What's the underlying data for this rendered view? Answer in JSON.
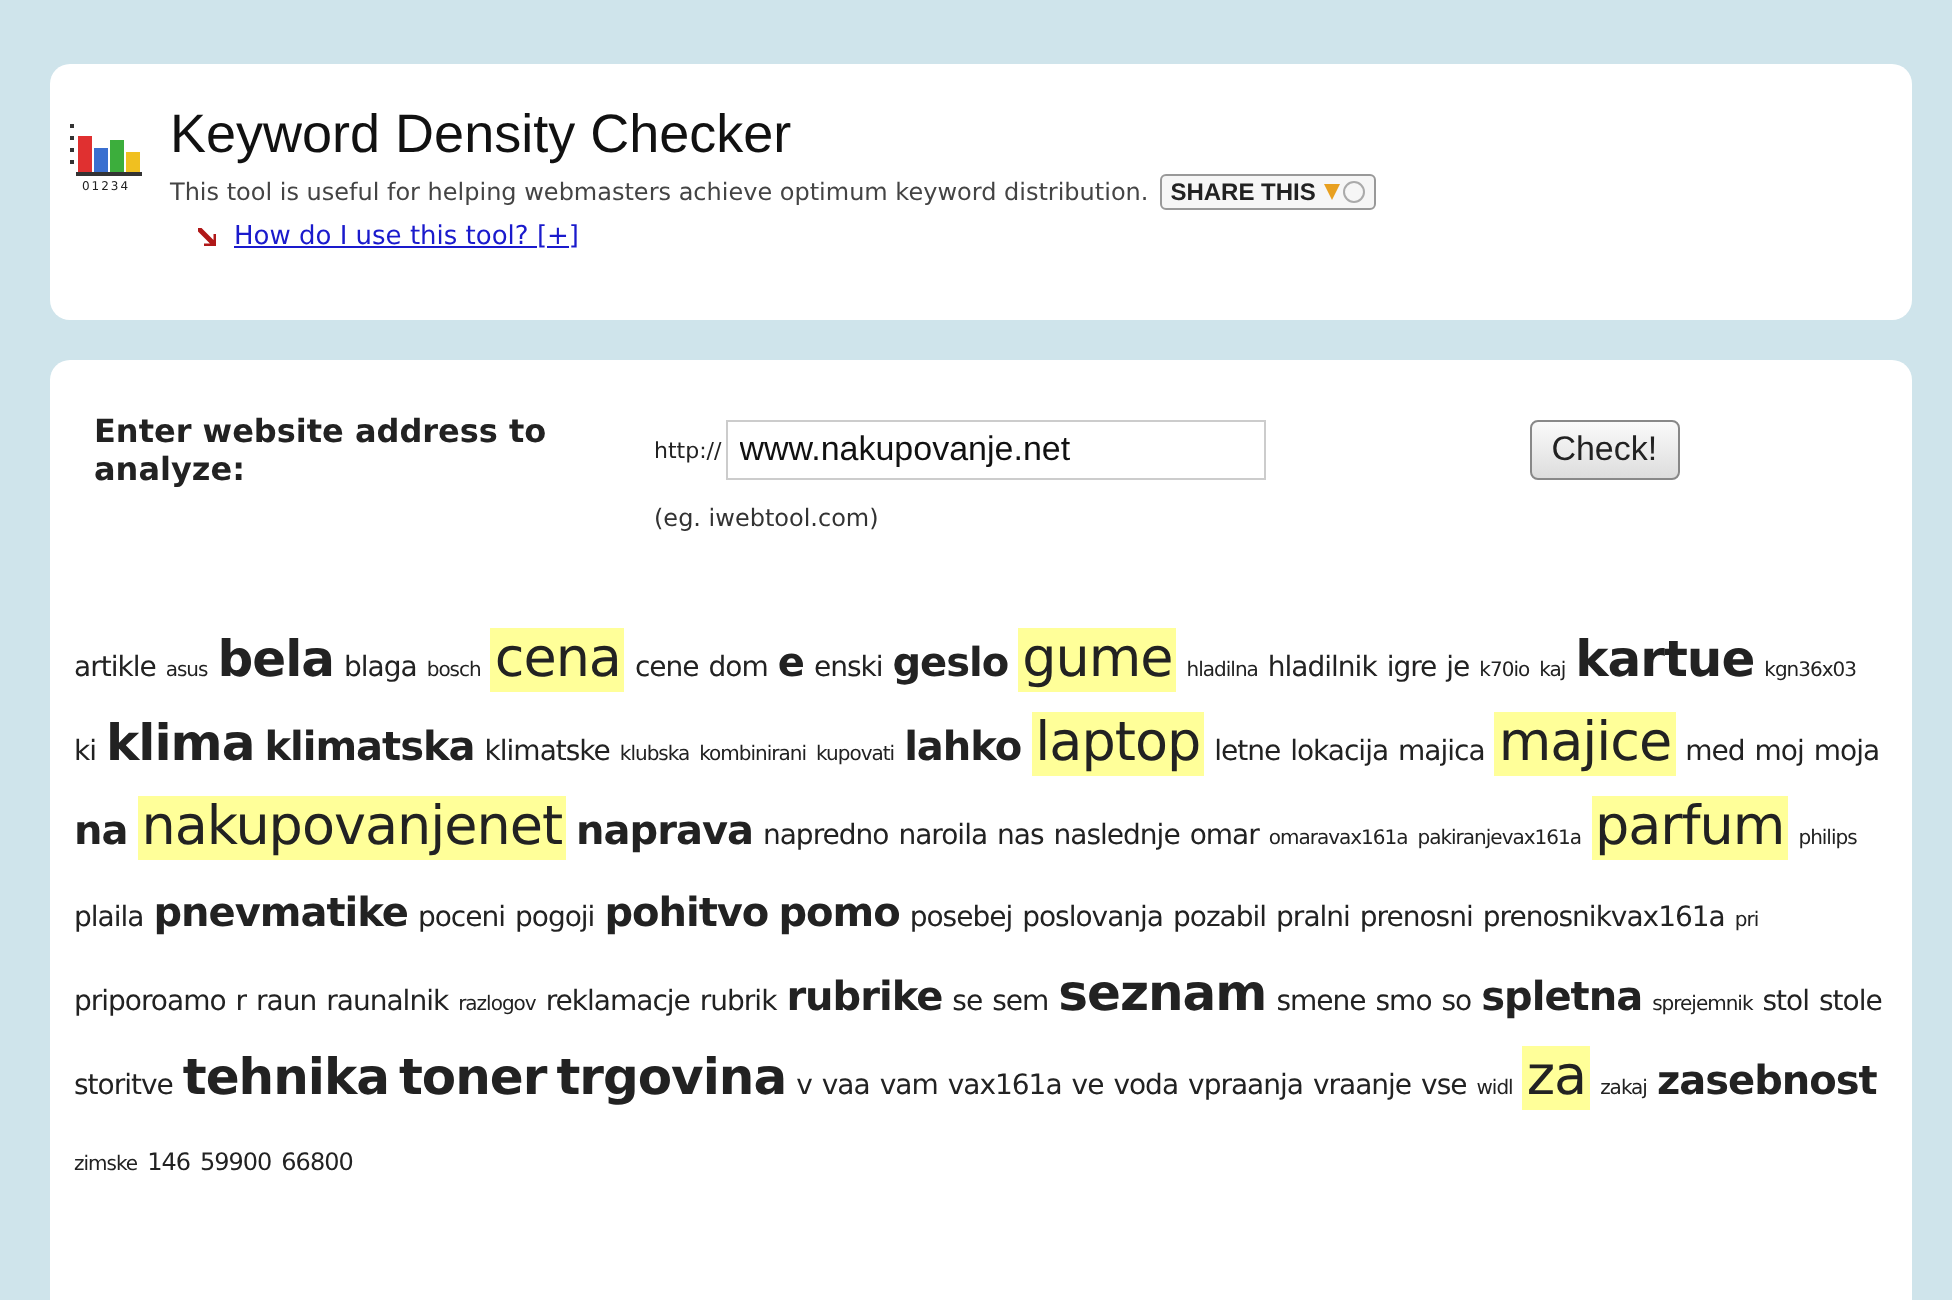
{
  "header": {
    "logo_digits": "01234",
    "title": "Keyword Density Checker",
    "description": "This tool is useful for helping webmasters achieve optimum keyword distribution.",
    "share_button": "SHARE THIS",
    "help_link": "How do I use this tool? [+]"
  },
  "form": {
    "label": "Enter website address to analyze:",
    "prefix": "http://",
    "url_value": "www.nakupovanje.net",
    "example": "(eg. iwebtool.com)",
    "submit": "Check!"
  },
  "keywords": [
    {
      "text": "artikle",
      "kind": "plain"
    },
    {
      "text": "asus",
      "kind": "tiny"
    },
    {
      "text": "bela",
      "kind": "heavy"
    },
    {
      "text": "blaga",
      "kind": "plain"
    },
    {
      "text": "bosch",
      "kind": "tiny"
    },
    {
      "text": "cena",
      "kind": "marked"
    },
    {
      "text": "cene",
      "kind": "plain"
    },
    {
      "text": "dom",
      "kind": "plain"
    },
    {
      "text": "e",
      "kind": "strong"
    },
    {
      "text": "enski",
      "kind": "plain"
    },
    {
      "text": "geslo",
      "kind": "strong"
    },
    {
      "text": "gume",
      "kind": "marked"
    },
    {
      "text": "hladilna",
      "kind": "tiny"
    },
    {
      "text": "hladilnik",
      "kind": "plain"
    },
    {
      "text": "igre",
      "kind": "plain"
    },
    {
      "text": "je",
      "kind": "plain"
    },
    {
      "text": "k70io",
      "kind": "tiny"
    },
    {
      "text": "kaj",
      "kind": "tiny"
    },
    {
      "text": "kartue",
      "kind": "heavy"
    },
    {
      "text": "kgn36x03",
      "kind": "tiny"
    },
    {
      "text": "ki",
      "kind": "plain"
    },
    {
      "text": "klima",
      "kind": "heavy"
    },
    {
      "text": "klimatska",
      "kind": "strong"
    },
    {
      "text": "klimatske",
      "kind": "plain"
    },
    {
      "text": "klubska",
      "kind": "tiny"
    },
    {
      "text": "kombinirani",
      "kind": "tiny"
    },
    {
      "text": "kupovati",
      "kind": "tiny"
    },
    {
      "text": "lahko",
      "kind": "strong"
    },
    {
      "text": "laptop",
      "kind": "marked"
    },
    {
      "text": "letne",
      "kind": "plain"
    },
    {
      "text": "lokacija",
      "kind": "plain"
    },
    {
      "text": "majica",
      "kind": "plain"
    },
    {
      "text": "majice",
      "kind": "marked"
    },
    {
      "text": "med",
      "kind": "plain"
    },
    {
      "text": "moj",
      "kind": "plain"
    },
    {
      "text": "moja",
      "kind": "plain"
    },
    {
      "text": "na",
      "kind": "strong"
    },
    {
      "text": "nakupovanjenet",
      "kind": "marked"
    },
    {
      "text": "naprava",
      "kind": "strong"
    },
    {
      "text": "napredno",
      "kind": "plain"
    },
    {
      "text": "naroila",
      "kind": "plain"
    },
    {
      "text": "nas",
      "kind": "plain"
    },
    {
      "text": "naslednje",
      "kind": "plain"
    },
    {
      "text": "omar",
      "kind": "plain"
    },
    {
      "text": "omaravax161a",
      "kind": "tiny"
    },
    {
      "text": "pakiranjevax161a",
      "kind": "tiny"
    },
    {
      "text": "parfum",
      "kind": "marked"
    },
    {
      "text": "philips",
      "kind": "tiny"
    },
    {
      "text": "plaila",
      "kind": "plain"
    },
    {
      "text": "pnevmatike",
      "kind": "strong"
    },
    {
      "text": "poceni",
      "kind": "plain"
    },
    {
      "text": "pogoji",
      "kind": "plain"
    },
    {
      "text": "pohitvo",
      "kind": "strong"
    },
    {
      "text": "pomo",
      "kind": "strong"
    },
    {
      "text": "posebej",
      "kind": "plain"
    },
    {
      "text": "poslovanja",
      "kind": "plain"
    },
    {
      "text": "pozabil",
      "kind": "plain"
    },
    {
      "text": "pralni",
      "kind": "plain"
    },
    {
      "text": "prenosni",
      "kind": "plain"
    },
    {
      "text": "prenosnikvax161a",
      "kind": "plain"
    },
    {
      "text": "pri",
      "kind": "tiny"
    },
    {
      "text": "priporoamo",
      "kind": "plain"
    },
    {
      "text": "r",
      "kind": "plain"
    },
    {
      "text": "raun",
      "kind": "plain"
    },
    {
      "text": "raunalnik",
      "kind": "plain"
    },
    {
      "text": "razlogov",
      "kind": "tiny"
    },
    {
      "text": "reklamacje",
      "kind": "plain"
    },
    {
      "text": "rubrik",
      "kind": "plain"
    },
    {
      "text": "rubrike",
      "kind": "strong"
    },
    {
      "text": "se",
      "kind": "plain"
    },
    {
      "text": "sem",
      "kind": "plain"
    },
    {
      "text": "seznam",
      "kind": "heavy"
    },
    {
      "text": "smene",
      "kind": "plain"
    },
    {
      "text": "smo",
      "kind": "plain"
    },
    {
      "text": "so",
      "kind": "plain"
    },
    {
      "text": "spletna",
      "kind": "strong"
    },
    {
      "text": "sprejemnik",
      "kind": "tiny"
    },
    {
      "text": "stol",
      "kind": "plain"
    },
    {
      "text": "stole",
      "kind": "plain"
    },
    {
      "text": "storitve",
      "kind": "plain"
    },
    {
      "text": "tehnika",
      "kind": "heavy"
    },
    {
      "text": "toner",
      "kind": "heavy"
    },
    {
      "text": "trgovina",
      "kind": "heavy"
    },
    {
      "text": "v",
      "kind": "plain"
    },
    {
      "text": "vaa",
      "kind": "plain"
    },
    {
      "text": "vam",
      "kind": "plain"
    },
    {
      "text": "vax161a",
      "kind": "plain"
    },
    {
      "text": "ve",
      "kind": "plain"
    },
    {
      "text": "voda",
      "kind": "plain"
    },
    {
      "text": "vpraanja",
      "kind": "plain"
    },
    {
      "text": "vraanje",
      "kind": "plain"
    },
    {
      "text": "vse",
      "kind": "plain"
    },
    {
      "text": "widl",
      "kind": "tiny"
    },
    {
      "text": "za",
      "kind": "marked"
    },
    {
      "text": "zakaj",
      "kind": "tiny"
    },
    {
      "text": "zasebnost",
      "kind": "strong"
    },
    {
      "text": "zimske",
      "kind": "tiny"
    },
    {
      "text": "146",
      "kind": "small"
    },
    {
      "text": "59900",
      "kind": "small"
    },
    {
      "text": "66800",
      "kind": "small"
    }
  ]
}
